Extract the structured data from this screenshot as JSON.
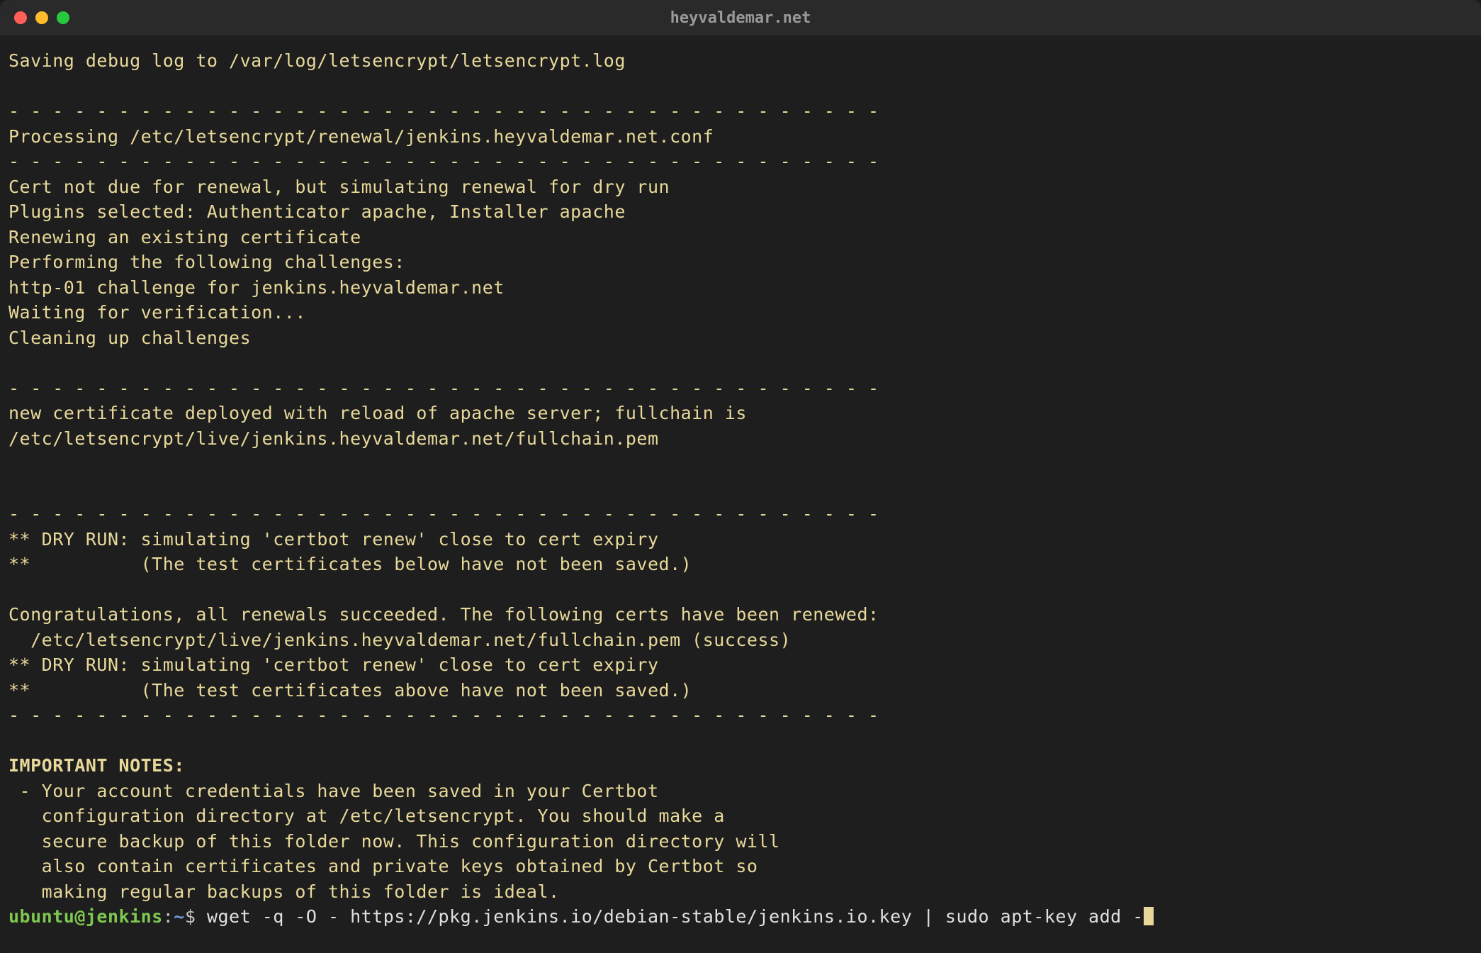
{
  "window": {
    "title": "heyvaldemar.net"
  },
  "terminal": {
    "lines": [
      "Saving debug log to /var/log/letsencrypt/letsencrypt.log",
      "",
      "- - - - - - - - - - - - - - - - - - - - - - - - - - - - - - - - - - - - - - - -",
      "Processing /etc/letsencrypt/renewal/jenkins.heyvaldemar.net.conf",
      "- - - - - - - - - - - - - - - - - - - - - - - - - - - - - - - - - - - - - - - -",
      "Cert not due for renewal, but simulating renewal for dry run",
      "Plugins selected: Authenticator apache, Installer apache",
      "Renewing an existing certificate",
      "Performing the following challenges:",
      "http-01 challenge for jenkins.heyvaldemar.net",
      "Waiting for verification...",
      "Cleaning up challenges",
      "",
      "- - - - - - - - - - - - - - - - - - - - - - - - - - - - - - - - - - - - - - - -",
      "new certificate deployed with reload of apache server; fullchain is",
      "/etc/letsencrypt/live/jenkins.heyvaldemar.net/fullchain.pem",
      "",
      "",
      "- - - - - - - - - - - - - - - - - - - - - - - - - - - - - - - - - - - - - - - -",
      "** DRY RUN: simulating 'certbot renew' close to cert expiry",
      "**          (The test certificates below have not been saved.)",
      "",
      "Congratulations, all renewals succeeded. The following certs have been renewed:",
      "  /etc/letsencrypt/live/jenkins.heyvaldemar.net/fullchain.pem (success)",
      "** DRY RUN: simulating 'certbot renew' close to cert expiry",
      "**          (The test certificates above have not been saved.)",
      "- - - - - - - - - - - - - - - - - - - - - - - - - - - - - - - - - - - - - - - -",
      ""
    ],
    "important_notes_header": "IMPORTANT NOTES:",
    "important_notes": [
      " - Your account credentials have been saved in your Certbot",
      "   configuration directory at /etc/letsencrypt. You should make a",
      "   secure backup of this folder now. This configuration directory will",
      "   also contain certificates and private keys obtained by Certbot so",
      "   making regular backups of this folder is ideal."
    ],
    "prompt": {
      "user_host": "ubuntu@jenkins",
      "colon": ":",
      "path": "~",
      "symbol": "$",
      "command": " wget -q -O - https://pkg.jenkins.io/debian-stable/jenkins.io.key | sudo apt-key add -"
    }
  }
}
